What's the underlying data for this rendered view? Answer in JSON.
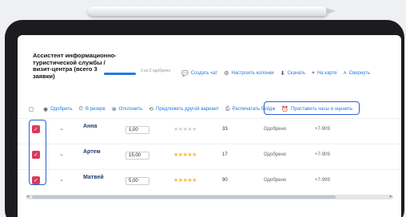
{
  "header": {
    "job_title": "Ассистент информационно-туристической службы / визит-центра (всего 3 заявки)",
    "progress_text": "3 из 3 одобрено",
    "progress_value": 1.0,
    "actions": [
      "Создать чат",
      "Настроить колонки",
      "Скачать",
      "На карте",
      "Свернуть"
    ]
  },
  "toolbar": {
    "actions": [
      "Одобрить",
      "В резерв",
      "Отклонить",
      "Предложить другой вариант",
      "Распечатать бейдж",
      "Проставить часы и оценить"
    ]
  },
  "rows": [
    {
      "name": "Анна",
      "hours": "1,00",
      "rating": 0,
      "score": "33",
      "status": "Одобрено",
      "phone": "+7-909"
    },
    {
      "name": "Артем",
      "hours": "15,00",
      "rating": 5,
      "score": "17",
      "status": "Одобрено",
      "phone": "+7-909"
    },
    {
      "name": "Матвей",
      "hours": "5,00",
      "rating": 5,
      "score": "90",
      "status": "Одобрено",
      "phone": "+7-999"
    }
  ],
  "icons": {
    "chat": "chat-icon",
    "settings": "gear-icon",
    "download": "download-icon",
    "map": "map-pin-icon",
    "collapse": "chevron-up-icon",
    "checkbox": "checkbox-icon",
    "expand": "chevron-down-icon",
    "star": "star-icon"
  },
  "colors": {
    "accent": "#1f7be6",
    "checked": "#d93a5a",
    "highlight": "#2b5fd9",
    "star_filled": "#f6b93b",
    "star_empty": "#c9ced6"
  }
}
